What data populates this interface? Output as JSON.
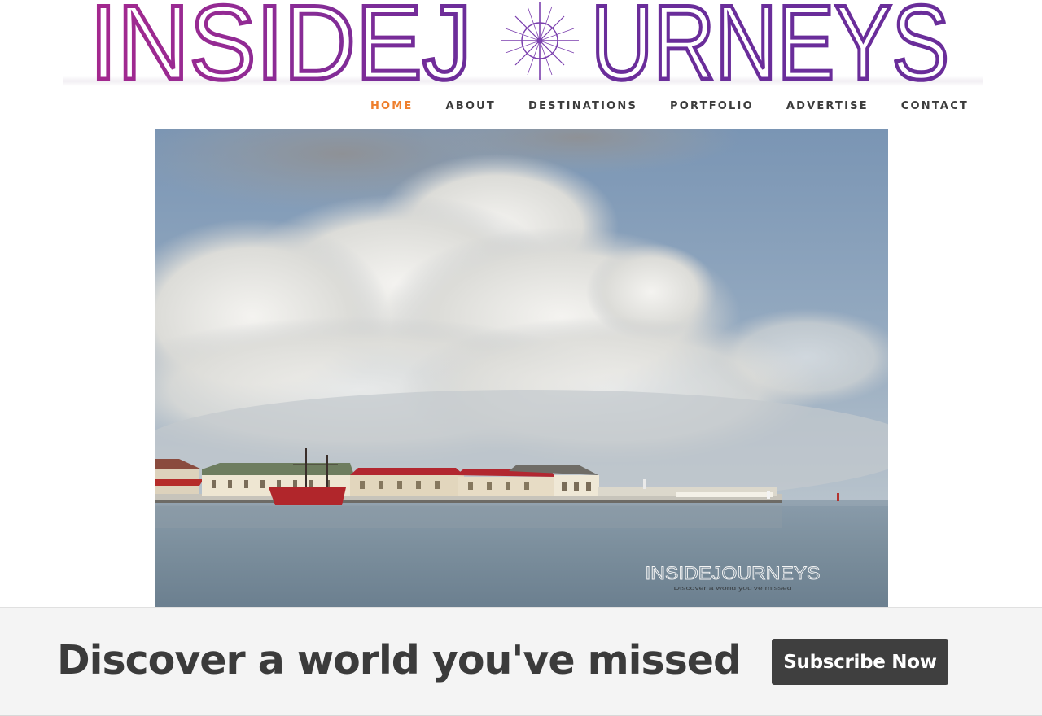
{
  "site": {
    "logo_left": "INSIDEJ",
    "logo_right": "URNEYS",
    "colors": {
      "logo_left": "#9b2d8f",
      "logo_right": "#6a2d9a",
      "nav_active": "#ee7f2d",
      "nav_text": "#3c3c3c",
      "button_bg": "#3f3f3f",
      "bar_bg": "#f4f4f4"
    }
  },
  "nav": {
    "items": [
      {
        "label": "HOME",
        "active": true
      },
      {
        "label": "ABOUT",
        "active": false
      },
      {
        "label": "DESTINATIONS",
        "active": false
      },
      {
        "label": "PORTFOLIO",
        "active": false
      },
      {
        "label": "ADVERTISE",
        "active": false
      },
      {
        "label": "CONTACT",
        "active": false
      }
    ]
  },
  "hero": {
    "watermark": "INSIDEJOURNEYS",
    "watermark_sub": "Discover a world you've missed"
  },
  "subscribe": {
    "tagline": "Discover a world you've missed",
    "button_label": "Subscribe Now"
  }
}
